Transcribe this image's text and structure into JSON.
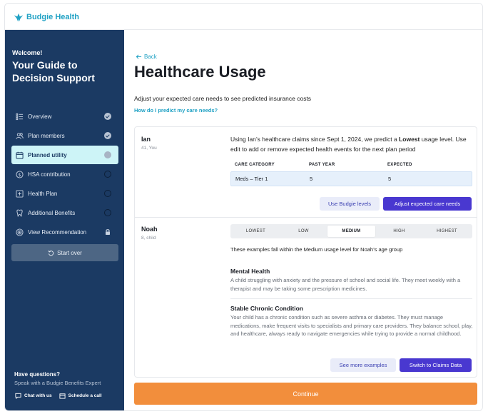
{
  "app": {
    "brand": "Budgie Health"
  },
  "sidebar": {
    "welcome": "Welcome!",
    "title": "Your Guide to Decision Support",
    "items": [
      {
        "label": "Overview",
        "icon": "list-icon",
        "status": "complete"
      },
      {
        "label": "Plan members",
        "icon": "people-icon",
        "status": "complete"
      },
      {
        "label": "Planned utility",
        "icon": "calendar-icon",
        "status": "current"
      },
      {
        "label": "HSA contribution",
        "icon": "dollar-icon",
        "status": "pending"
      },
      {
        "label": "Health Plan",
        "icon": "medical-plus-icon",
        "status": "pending"
      },
      {
        "label": "Additional Benefits",
        "icon": "tooth-icon",
        "status": "pending"
      },
      {
        "label": "View Recommendation",
        "icon": "target-icon",
        "status": "locked"
      }
    ],
    "start_over": "Start over",
    "questions": "Have questions?",
    "speak": "Speak with a Budgie Benefits Expert",
    "chat": "Chat with us",
    "schedule": "Schedule a call"
  },
  "main": {
    "back": "Back",
    "title": "Healthcare Usage",
    "subtitle": "Adjust your expected care needs to see predicted insurance costs",
    "how_link": "How do I predict my care needs?"
  },
  "members": [
    {
      "name": "Ian",
      "meta": "41, You",
      "para_pre": "Using Ian’s healthcare claims since Sept 1, 2024, we predict a ",
      "para_bold": "Lowest",
      "para_post": " usage level. Use edit to add or remove expected health events for the next plan period",
      "table": {
        "headers": [
          "CARE CATEGORY",
          "PAST YEAR",
          "EXPECTED"
        ],
        "rows": [
          [
            "Meds – Tier 1",
            "5",
            "5"
          ]
        ]
      },
      "btn_secondary": "Use Budgie levels",
      "btn_primary": "Adjust expected care needs"
    },
    {
      "name": "Noah",
      "meta": "8, child",
      "levels": [
        "LOWEST",
        "LOW",
        "MEDIUM",
        "HIGH",
        "HIGHEST"
      ],
      "selected_level": "MEDIUM",
      "note": "These examples fall within the Medium usage level for Noah’s age group",
      "examples": [
        {
          "title": "Mental Health",
          "desc": "A child struggling with anxiety and the pressure of school and social life. They meet weekly with a therapist and may be taking some prescription medicines."
        },
        {
          "title": "Stable Chronic Condition",
          "desc": "Your child has a chronic condition such as severe asthma or diabetes. They must manage medications, make frequent visits to specialists and primary care providers. They balance school, play, and healthcare, always ready to navigate emergencies while trying to provide a normal childhood."
        }
      ],
      "btn_secondary": "See more examples",
      "btn_primary": "Switch to Claims Data"
    }
  ],
  "footer": {
    "continue": "Continue"
  },
  "colors": {
    "brand": "#1fa1c4",
    "sidebar": "#1b3a63",
    "primary": "#4938d0",
    "cta": "#f28e3c"
  }
}
